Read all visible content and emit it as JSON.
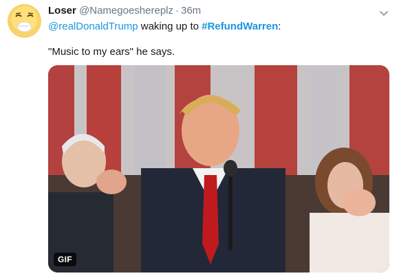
{
  "author": {
    "display_name": "Loser",
    "handle": "@Namegoeshereplz",
    "separator": "·",
    "timestamp": "36m",
    "avatar_icon": "sneezing-emoji-avatar"
  },
  "tweet": {
    "mention": "@realDonaldTrump",
    "text_middle": " waking up to ",
    "hashtag": "#RefundWarren",
    "text_end": ":",
    "body": "\"Music to my ears\" he says."
  },
  "media": {
    "badge": "GIF",
    "description_icon": "gif-still-image"
  },
  "menu": {
    "icon": "chevron-down-icon"
  },
  "colors": {
    "link": "#1b95e0",
    "secondary_text": "#657786",
    "primary_text": "#14171a"
  }
}
